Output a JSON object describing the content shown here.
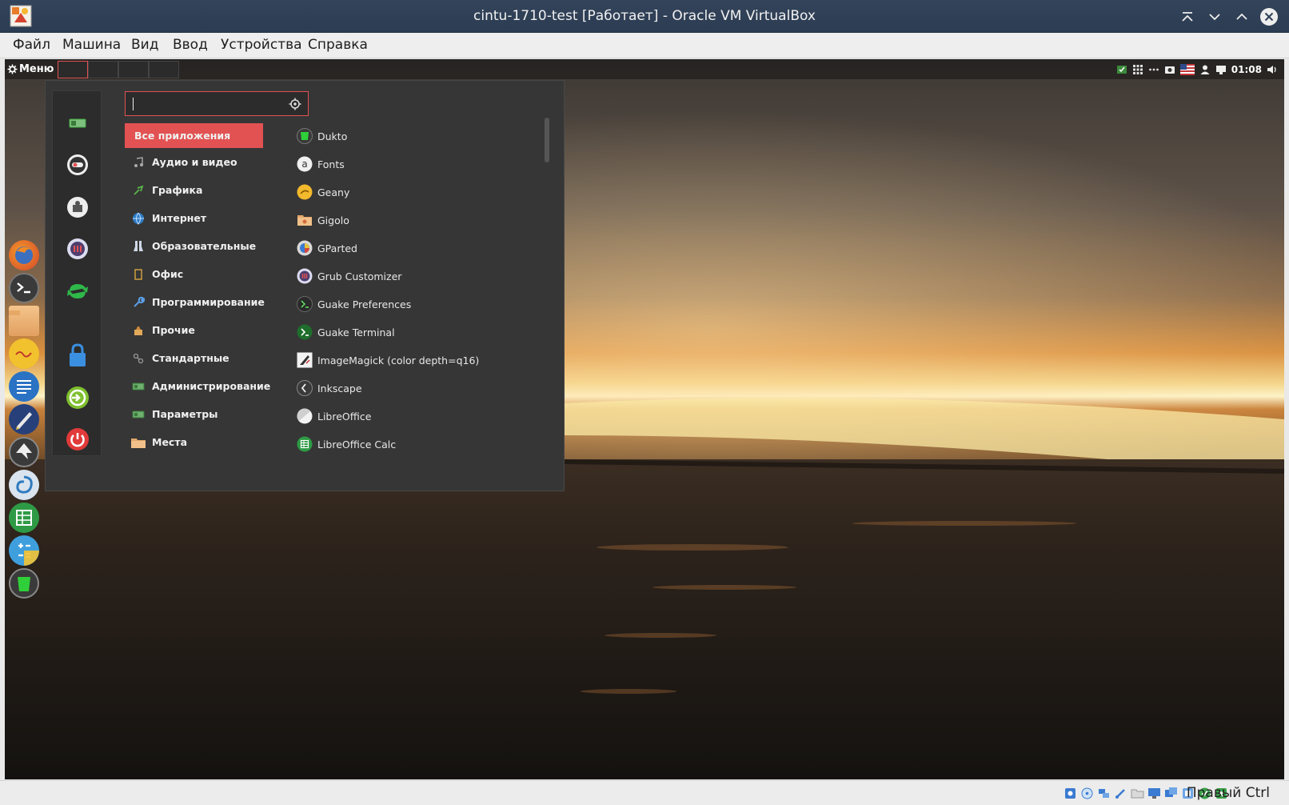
{
  "window": {
    "title": "cintu-1710-test [Работает] - Oracle VM VirtualBox"
  },
  "menubar": {
    "items": [
      "Файл",
      "Машина",
      "Вид",
      "Ввод",
      "Устройства",
      "Справка"
    ]
  },
  "guest_panel": {
    "menu_label": "Меню",
    "clock": "01:08",
    "workspaces": 4,
    "active_workspace": 1
  },
  "search": {
    "value": ""
  },
  "categories": [
    {
      "label": "Все приложения",
      "icon": "none",
      "active": true
    },
    {
      "label": "Аудио и видео",
      "icon": "music-note-icon",
      "active": false
    },
    {
      "label": "Графика",
      "icon": "graphics-icon",
      "active": false
    },
    {
      "label": "Интернет",
      "icon": "globe-icon",
      "active": false
    },
    {
      "label": "Образовательные",
      "icon": "flask-icon",
      "active": false
    },
    {
      "label": "Офис",
      "icon": "office-icon",
      "active": false
    },
    {
      "label": "Программирование",
      "icon": "wrench-icon",
      "active": false
    },
    {
      "label": "Прочие",
      "icon": "box-icon",
      "active": false
    },
    {
      "label": "Стандартные",
      "icon": "accessories-icon",
      "active": false
    },
    {
      "label": "Администрирование",
      "icon": "admin-icon",
      "active": false
    },
    {
      "label": "Параметры",
      "icon": "settings-icon",
      "active": false
    },
    {
      "label": "Места",
      "icon": "folder-icon",
      "active": false
    }
  ],
  "apps": [
    {
      "label": "Dukto",
      "icon": "dukto-icon"
    },
    {
      "label": "Fonts",
      "icon": "fonts-icon"
    },
    {
      "label": "Geany",
      "icon": "geany-icon"
    },
    {
      "label": "Gigolo",
      "icon": "gigolo-icon"
    },
    {
      "label": "GParted",
      "icon": "gparted-icon"
    },
    {
      "label": "Grub Customizer",
      "icon": "grub-customizer-icon"
    },
    {
      "label": "Guake Preferences",
      "icon": "guake-preferences-icon"
    },
    {
      "label": "Guake Terminal",
      "icon": "guake-terminal-icon"
    },
    {
      "label": "ImageMagick (color depth=q16)",
      "icon": "imagemagick-icon"
    },
    {
      "label": "Inkscape",
      "icon": "inkscape-icon"
    },
    {
      "label": "LibreOffice",
      "icon": "libreoffice-icon"
    },
    {
      "label": "LibreOffice Calc",
      "icon": "libreoffice-calc-icon"
    }
  ],
  "statusbar": {
    "host_key": "Правый Ctrl"
  },
  "colors": {
    "accent": "#e25252",
    "menu_bg": "#363636",
    "title_bar": "#2f3f55"
  }
}
